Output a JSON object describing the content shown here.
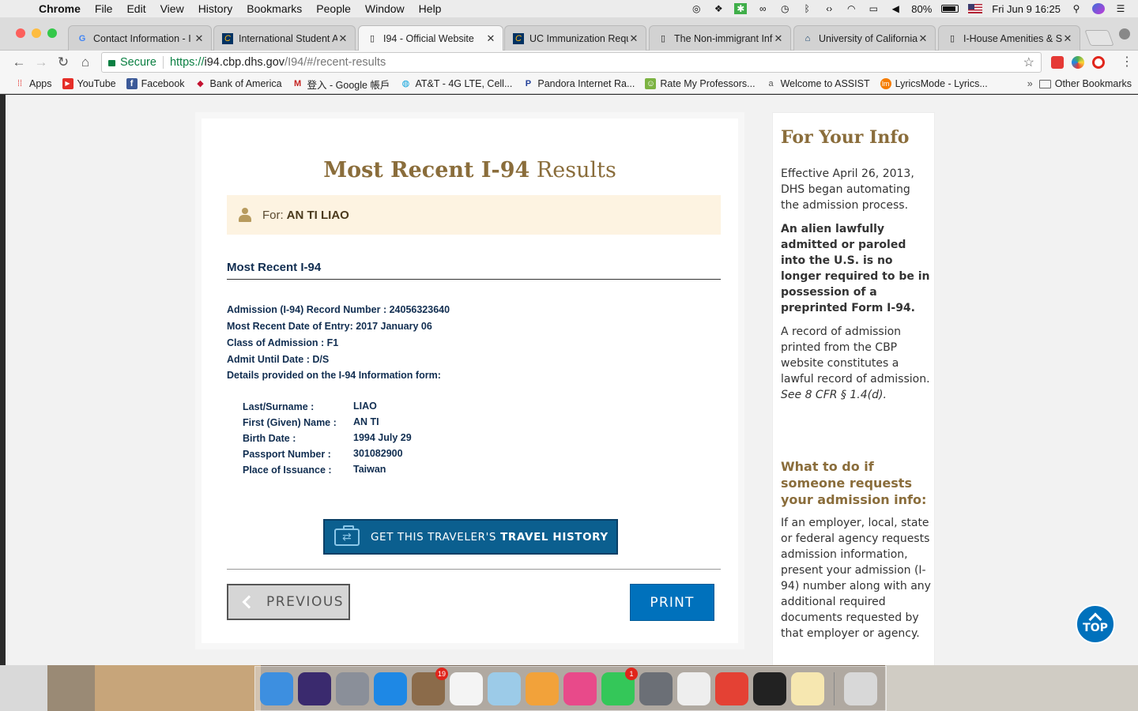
{
  "menubar": {
    "app": "Chrome",
    "items": [
      "File",
      "Edit",
      "View",
      "History",
      "Bookmarks",
      "People",
      "Window",
      "Help"
    ],
    "battery": "80%",
    "datetime": "Fri Jun 9  16:25"
  },
  "tabs": [
    {
      "title": "Contact Information - I",
      "icon": "google-icon"
    },
    {
      "title": "International Student A",
      "icon": "cal-icon"
    },
    {
      "title": "I94 - Official Website",
      "icon": "page-icon",
      "active": true
    },
    {
      "title": "UC Immunization Requ",
      "icon": "cal-icon"
    },
    {
      "title": "The Non-immigrant Inf",
      "icon": "page-icon"
    },
    {
      "title": "University of California",
      "icon": "home-icon"
    },
    {
      "title": "I-House Amenities & S",
      "icon": "page-icon"
    }
  ],
  "omnibox": {
    "secure": "Secure",
    "scheme": "https://",
    "host": "i94.cbp.dhs.gov",
    "path": "/I94/#/recent-results"
  },
  "bookmarks": [
    {
      "label": "Apps",
      "icon": "apps-grid-icon",
      "color": "#e53935"
    },
    {
      "label": "YouTube",
      "icon": "youtube-icon",
      "color": "#e52d27"
    },
    {
      "label": "Facebook",
      "icon": "facebook-icon",
      "color": "#3b5998"
    },
    {
      "label": "Bank of America",
      "icon": "bofa-icon",
      "color": "#c41230"
    },
    {
      "label": "登入 - Google 帳戶",
      "icon": "gmail-icon",
      "color": "#c5221f"
    },
    {
      "label": "AT&T - 4G LTE, Cell...",
      "icon": "att-icon",
      "color": "#009fdb"
    },
    {
      "label": "Pandora Internet Ra...",
      "icon": "pandora-icon",
      "color": "#224099"
    },
    {
      "label": "Rate My Professors...",
      "icon": "rmp-icon",
      "color": "#7cb342"
    },
    {
      "label": "Welcome to ASSIST",
      "icon": "assist-icon",
      "color": "#555555"
    },
    {
      "label": "LyricsMode - Lyrics...",
      "icon": "lyricsmode-icon",
      "color": "#f57c00"
    }
  ],
  "bookmarks_more": "»",
  "other_bookmarks": "Other Bookmarks",
  "results": {
    "title_bold": "Most Recent I-94",
    "title_rest": "Results",
    "for_label": "For:",
    "for_name": "AN TI LIAO",
    "section": "Most Recent I-94",
    "records": [
      "Admission (I-94) Record Number : 24056323640",
      "Most Recent Date of Entry: 2017 January 06",
      "Class of Admission : F1",
      "Admit Until Date : D/S",
      "Details provided on the I-94 Information form:"
    ],
    "details": [
      {
        "label": "Last/Surname :",
        "value": "LIAO"
      },
      {
        "label": "First (Given) Name :",
        "value": "AN TI"
      },
      {
        "label": "Birth Date :",
        "value": "1994 July 29"
      },
      {
        "label": "Passport Number :",
        "value": "301082900"
      },
      {
        "label": "Place of Issuance :",
        "value": "Taiwan"
      }
    ],
    "travel_btn_pre": "GET THIS TRAVELER'S",
    "travel_btn_bold": "TRAVEL HISTORY",
    "previous": "PREVIOUS",
    "print": "PRINT"
  },
  "sidebar": {
    "title": "For Your Info",
    "p1": "Effective April 26, 2013, DHS began automating the admission process.",
    "p2": "An alien lawfully admitted or paroled into the U.S. is no longer required to be in possession of a preprinted Form I-94.",
    "p3": "A record of admission printed from the CBP website constitutes a lawful record of admission.",
    "p3_cite": "See 8 CFR § 1.4(d).",
    "h2": "What to do if someone requests your admission info:",
    "p4": "If an employer, local, state or federal agency requests admission information, present your admission (I-94) number along with any additional required documents requested by that employer or agency."
  },
  "top_button": "TOP",
  "dock": [
    {
      "name": "finder-icon",
      "color": "#3d8fe0"
    },
    {
      "name": "siri-icon",
      "color": "#3a2a6e"
    },
    {
      "name": "launchpad-icon",
      "color": "#8a8f99"
    },
    {
      "name": "safari-icon",
      "color": "#1e88e5"
    },
    {
      "name": "mail-icon",
      "color": "#8b6b4a",
      "badge": "19"
    },
    {
      "name": "reminders-icon",
      "color": "#f4f4f4"
    },
    {
      "name": "preview-icon",
      "color": "#9ccbe8"
    },
    {
      "name": "photos-icon",
      "color": "#f2a23a"
    },
    {
      "name": "itunes-icon",
      "color": "#e84a8a"
    },
    {
      "name": "facetime-icon",
      "color": "#34c759",
      "badge": "1"
    },
    {
      "name": "system-preferences-icon",
      "color": "#6b6f76"
    },
    {
      "name": "sketch-app-icon",
      "color": "#eeeeee"
    },
    {
      "name": "chrome-icon",
      "color": "#e44134"
    },
    {
      "name": "acrobat-icon",
      "color": "#222222"
    },
    {
      "name": "textedit-icon",
      "color": "#f6e7b0"
    },
    {
      "name": "trash-icon",
      "color": "#d8d8d8"
    }
  ]
}
